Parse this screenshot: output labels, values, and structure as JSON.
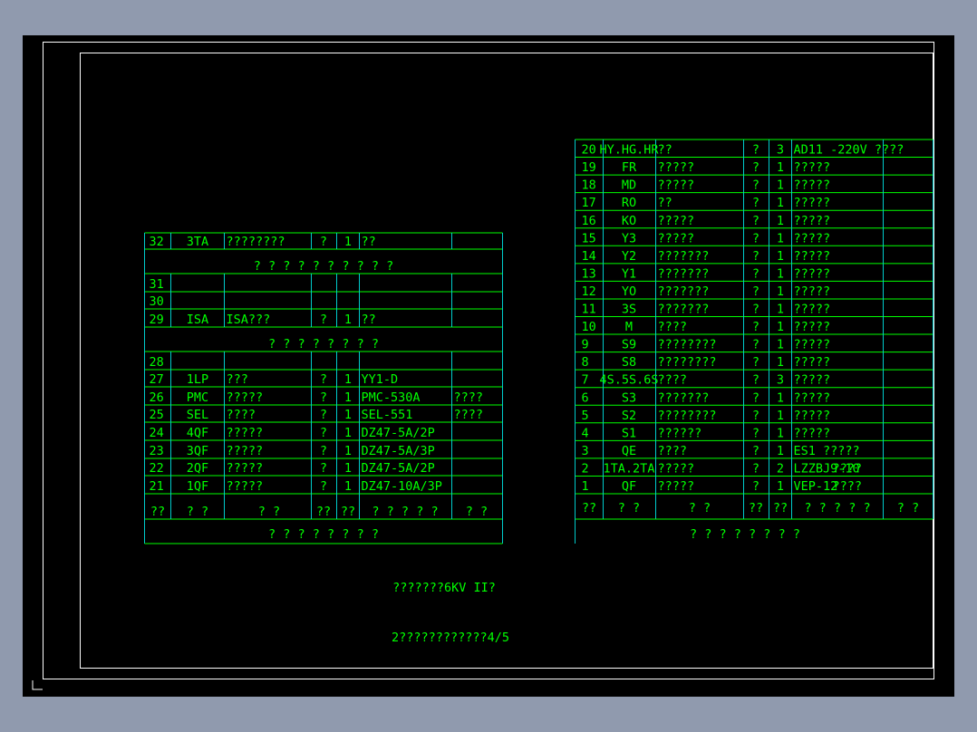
{
  "colors": {
    "background": "#000000",
    "text": "#00ff00",
    "vertical_lines": "#00cccc",
    "frame": "#ffffff",
    "outer": "#909aae"
  },
  "caption_1": "???????6KV II?",
  "caption_2": "2????????????4/5",
  "left_table": {
    "groups": [
      {
        "type": "row",
        "cells": [
          "32",
          "3TA",
          "????????",
          "?",
          "1",
          "??",
          ""
        ]
      },
      {
        "type": "title",
        "text": "? ? ? ? ? ? ? ? ? ?"
      },
      {
        "type": "row",
        "cells": [
          "31",
          "",
          "",
          "",
          "",
          "",
          ""
        ]
      },
      {
        "type": "row",
        "cells": [
          "30",
          "",
          "",
          "",
          "",
          "",
          ""
        ]
      },
      {
        "type": "row",
        "cells": [
          "29",
          "ISA",
          "ISA???",
          "?",
          "1",
          "??",
          ""
        ]
      },
      {
        "type": "title",
        "text": "? ? ? ? ? ? ? ?"
      },
      {
        "type": "row",
        "cells": [
          "28",
          "",
          "",
          "",
          "",
          "",
          ""
        ]
      },
      {
        "type": "row",
        "cells": [
          "27",
          "1LP",
          "???",
          "?",
          "1",
          "YY1-D",
          ""
        ]
      },
      {
        "type": "row",
        "cells": [
          "26",
          "PMC",
          "?????",
          "?",
          "1",
          "PMC-530A",
          "????"
        ]
      },
      {
        "type": "row",
        "cells": [
          "25",
          "SEL",
          "????",
          "?",
          "1",
          "SEL-551",
          "????"
        ]
      },
      {
        "type": "row",
        "cells": [
          "24",
          "4QF",
          "?????",
          "?",
          "1",
          "DZ47-5A/2P",
          ""
        ]
      },
      {
        "type": "row",
        "cells": [
          "23",
          "3QF",
          "?????",
          "?",
          "1",
          "DZ47-5A/3P",
          ""
        ]
      },
      {
        "type": "row",
        "cells": [
          "22",
          "2QF",
          "?????",
          "?",
          "1",
          "DZ47-5A/2P",
          ""
        ]
      },
      {
        "type": "row",
        "cells": [
          "21",
          "1QF",
          "?????",
          "?",
          "1",
          "DZ47-10A/3P",
          ""
        ]
      },
      {
        "type": "header",
        "cells": [
          "??",
          "?  ?",
          "?    ?",
          "??",
          "??",
          "? ? ? ? ?",
          "? ?"
        ]
      }
    ],
    "footer_title": "? ? ? ? ? ? ? ?"
  },
  "right_table": {
    "rows": [
      [
        "20",
        "HY.HG.HR",
        "??",
        "?",
        "3",
        "AD11 -220V ????",
        ""
      ],
      [
        "19",
        "FR",
        "?????",
        "?",
        "1",
        "?????",
        ""
      ],
      [
        "18",
        "MD",
        "?????",
        "?",
        "1",
        "?????",
        ""
      ],
      [
        "17",
        "RO",
        "??",
        "?",
        "1",
        "?????",
        ""
      ],
      [
        "16",
        "KO",
        "?????",
        "?",
        "1",
        "?????",
        ""
      ],
      [
        "15",
        "Y3",
        "?????",
        "?",
        "1",
        "?????",
        ""
      ],
      [
        "14",
        "Y2",
        "???????",
        "?",
        "1",
        "?????",
        ""
      ],
      [
        "13",
        "Y1",
        "???????",
        "?",
        "1",
        "?????",
        ""
      ],
      [
        "12",
        "YO",
        "???????",
        "?",
        "1",
        "?????",
        ""
      ],
      [
        "11",
        "3S",
        "???????",
        "?",
        "1",
        "?????",
        ""
      ],
      [
        "10",
        "M",
        "????",
        "?",
        "1",
        "?????",
        ""
      ],
      [
        "9",
        "S9",
        "????????",
        "?",
        "1",
        "?????",
        ""
      ],
      [
        "8",
        "S8",
        "????????",
        "?",
        "1",
        "?????",
        ""
      ],
      [
        "7",
        "4S.5S.6S",
        "????",
        "?",
        "3",
        "?????",
        ""
      ],
      [
        "6",
        "S3",
        "???????",
        "?",
        "1",
        "?????",
        ""
      ],
      [
        "5",
        "S2",
        "????????",
        "?",
        "1",
        "?????",
        ""
      ],
      [
        "4",
        "S1",
        "??????",
        "?",
        "1",
        "?????",
        ""
      ],
      [
        "3",
        "QE",
        "????",
        "?",
        "1",
        "ES1   ?????",
        ""
      ],
      [
        "2",
        "1TA.2TA",
        "?????",
        "?",
        "2",
        "LZZBJ9-10",
        "????"
      ],
      [
        "1",
        "QF",
        "?????",
        "?",
        "1",
        "VEP-12",
        "????"
      ]
    ],
    "header": [
      "??",
      "?  ?",
      "?    ?",
      "??",
      "??",
      "? ? ? ? ?",
      "? ?"
    ],
    "footer_title": "? ? ? ? ? ? ? ?"
  }
}
